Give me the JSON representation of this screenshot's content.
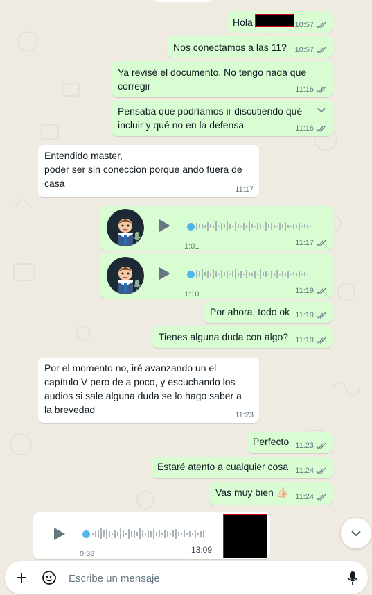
{
  "messages": [
    {
      "text": "Hola",
      "time": "10:57"
    },
    {
      "text": "Nos conectamos a las 11?",
      "time": "10:57"
    },
    {
      "text": "Ya revisé el documento. No tengo nada que\ncorregir",
      "time": "11:16"
    },
    {
      "text": "Pensaba que podríamos ir discutiendo qué\nincluir y qué no en la defensa",
      "time": "11:16"
    },
    {
      "text": "Entendido master,\n poder ser sin coneccion porque ando fuera de\ncasa",
      "time": "11:17"
    },
    {
      "duration": "1:01",
      "time": "11:17"
    },
    {
      "duration": "1:10",
      "time": "11:19"
    },
    {
      "text": "Por ahora, todo ok",
      "time": "11:19"
    },
    {
      "text": "Tienes alguna duda con algo?",
      "time": "11:19"
    },
    {
      "text": "Por el momento no, iré avanzando un el\ncapítulo V pero de a poco, y escuchando los\naudios si sale alguna duda se lo hago saber a\nla brevedad",
      "time": "11:23"
    },
    {
      "text": "Perfecto",
      "time": "11:23"
    },
    {
      "text": "Estaré atento a cualquier cosa",
      "time": "11:24"
    },
    {
      "text": "Vas muy bien 👍🏻",
      "time": "11:24"
    },
    {
      "duration": "0:38",
      "time": "13:09"
    }
  ],
  "composer": {
    "placeholder": "Escribe un mensaje"
  },
  "colors": {
    "outgoing": "#d9fdd3",
    "incoming": "#ffffff",
    "tick": "#667781",
    "progress_dot": "#4fb6ec"
  },
  "icons": {
    "add": "plus-icon",
    "sticker": "sticker-icon",
    "mic": "microphone-icon",
    "scroll": "chevron-down-icon"
  }
}
